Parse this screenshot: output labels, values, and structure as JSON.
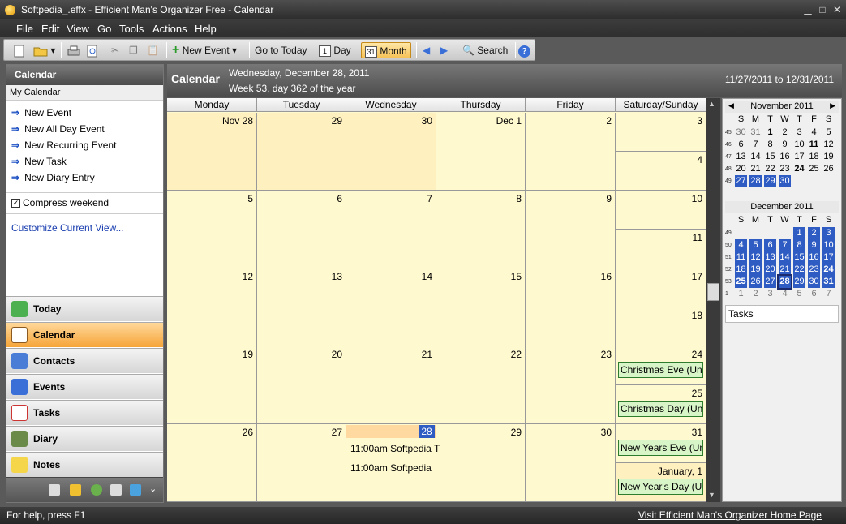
{
  "window": {
    "title": "Softpedia_.effx - Efficient Man's Organizer Free - Calendar",
    "minimize": "▁",
    "maximize": "□",
    "close": "✕"
  },
  "menu": [
    "File",
    "Edit",
    "View",
    "Go",
    "Tools",
    "Actions",
    "Help"
  ],
  "toolbar": {
    "new_event": "New Event",
    "go_to_today": "Go to Today",
    "day": "Day",
    "month": "Month",
    "search": "Search"
  },
  "left_panel": {
    "header": "Calendar",
    "subheader": "My Calendar",
    "actions": [
      "New Event",
      "New All Day Event",
      "New Recurring Event",
      "New Task",
      "New Diary Entry"
    ],
    "compress_weekend": "Compress weekend",
    "customize": "Customize Current View...",
    "nav": [
      "Today",
      "Calendar",
      "Contacts",
      "Events",
      "Tasks",
      "Diary",
      "Notes"
    ]
  },
  "calendar_header": {
    "title": "Calendar",
    "date": "Wednesday, December 28, 2011",
    "week": "Week 53, day 362 of the year",
    "range": "11/27/2011 to 12/31/2011"
  },
  "day_headers": [
    "Monday",
    "Tuesday",
    "Wednesday",
    "Thursday",
    "Friday",
    "Saturday/Sunday"
  ],
  "weeks": [
    {
      "days": [
        "Nov 28",
        "29",
        "30",
        "Dec 1",
        "2"
      ],
      "sat": "3",
      "sun": "4"
    },
    {
      "days": [
        "5",
        "6",
        "7",
        "8",
        "9"
      ],
      "sat": "10",
      "sun": "11"
    },
    {
      "days": [
        "12",
        "13",
        "14",
        "15",
        "16"
      ],
      "sat": "17",
      "sun": "18"
    },
    {
      "days": [
        "19",
        "20",
        "21",
        "22",
        "23"
      ],
      "sat": "24",
      "sun": "25"
    },
    {
      "days": [
        "26",
        "27",
        "28",
        "29",
        "30"
      ],
      "sat": "31",
      "sun": "January, 1"
    }
  ],
  "events": {
    "christmas_eve": "Christmas Eve (United",
    "christmas_day": "Christmas Day (United",
    "new_years_eve": "New Years Eve (United",
    "new_years_day": "New Year's Day (United",
    "wed28_1": "11:00am Softpedia T",
    "wed28_2": "11:00am Softpedia"
  },
  "mini_calendars": [
    {
      "title": "November 2011",
      "dow": [
        "S",
        "M",
        "T",
        "W",
        "T",
        "F",
        "S"
      ],
      "rows": [
        {
          "wk": "45",
          "d": [
            "30",
            "31",
            "1",
            "2",
            "3",
            "4",
            "5"
          ]
        },
        {
          "wk": "46",
          "d": [
            "6",
            "7",
            "8",
            "9",
            "10",
            "11",
            "12"
          ]
        },
        {
          "wk": "47",
          "d": [
            "13",
            "14",
            "15",
            "16",
            "17",
            "18",
            "19"
          ]
        },
        {
          "wk": "48",
          "d": [
            "20",
            "21",
            "22",
            "23",
            "24",
            "25",
            "26"
          ]
        },
        {
          "wk": "49",
          "d": [
            "27",
            "28",
            "29",
            "30",
            "",
            "",
            ""
          ]
        }
      ]
    },
    {
      "title": "December 2011",
      "dow": [
        "S",
        "M",
        "T",
        "W",
        "T",
        "F",
        "S"
      ],
      "rows": [
        {
          "wk": "49",
          "d": [
            "",
            "",
            "",
            "",
            "1",
            "2",
            "3"
          ]
        },
        {
          "wk": "50",
          "d": [
            "4",
            "5",
            "6",
            "7",
            "8",
            "9",
            "10"
          ]
        },
        {
          "wk": "51",
          "d": [
            "11",
            "12",
            "13",
            "14",
            "15",
            "16",
            "17"
          ]
        },
        {
          "wk": "52",
          "d": [
            "18",
            "19",
            "20",
            "21",
            "22",
            "23",
            "24"
          ]
        },
        {
          "wk": "53",
          "d": [
            "25",
            "26",
            "27",
            "28",
            "29",
            "30",
            "31"
          ]
        },
        {
          "wk": "1",
          "d": [
            "1",
            "2",
            "3",
            "4",
            "5",
            "6",
            "7"
          ]
        }
      ]
    }
  ],
  "tasks_label": "Tasks",
  "status": {
    "help": "For help, press F1",
    "link": "Visit Efficient Man's Organizer Home Page"
  },
  "colors": {
    "accent": "#2f5cc3",
    "cell_bg": "#fff9cf",
    "event_bg": "#d8f5c8",
    "active_nav": "#f6a538"
  }
}
